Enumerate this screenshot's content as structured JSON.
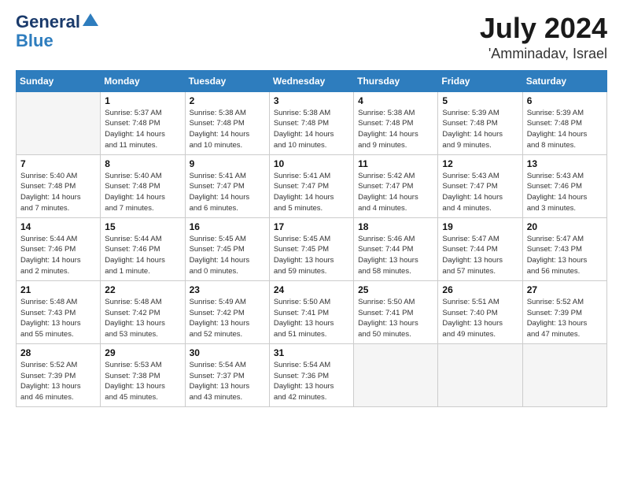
{
  "logo": {
    "line1": "General",
    "line2": "Blue"
  },
  "header": {
    "month_year": "July 2024",
    "location": "'Amminadav, Israel"
  },
  "days_of_week": [
    "Sunday",
    "Monday",
    "Tuesday",
    "Wednesday",
    "Thursday",
    "Friday",
    "Saturday"
  ],
  "weeks": [
    [
      {
        "day": "",
        "empty": true
      },
      {
        "day": "1",
        "sunrise": "5:37 AM",
        "sunset": "7:48 PM",
        "daylight": "14 hours and 11 minutes."
      },
      {
        "day": "2",
        "sunrise": "5:38 AM",
        "sunset": "7:48 PM",
        "daylight": "14 hours and 10 minutes."
      },
      {
        "day": "3",
        "sunrise": "5:38 AM",
        "sunset": "7:48 PM",
        "daylight": "14 hours and 10 minutes."
      },
      {
        "day": "4",
        "sunrise": "5:38 AM",
        "sunset": "7:48 PM",
        "daylight": "14 hours and 9 minutes."
      },
      {
        "day": "5",
        "sunrise": "5:39 AM",
        "sunset": "7:48 PM",
        "daylight": "14 hours and 9 minutes."
      },
      {
        "day": "6",
        "sunrise": "5:39 AM",
        "sunset": "7:48 PM",
        "daylight": "14 hours and 8 minutes."
      }
    ],
    [
      {
        "day": "7",
        "sunrise": "5:40 AM",
        "sunset": "7:48 PM",
        "daylight": "14 hours and 7 minutes."
      },
      {
        "day": "8",
        "sunrise": "5:40 AM",
        "sunset": "7:48 PM",
        "daylight": "14 hours and 7 minutes."
      },
      {
        "day": "9",
        "sunrise": "5:41 AM",
        "sunset": "7:47 PM",
        "daylight": "14 hours and 6 minutes."
      },
      {
        "day": "10",
        "sunrise": "5:41 AM",
        "sunset": "7:47 PM",
        "daylight": "14 hours and 5 minutes."
      },
      {
        "day": "11",
        "sunrise": "5:42 AM",
        "sunset": "7:47 PM",
        "daylight": "14 hours and 4 minutes."
      },
      {
        "day": "12",
        "sunrise": "5:43 AM",
        "sunset": "7:47 PM",
        "daylight": "14 hours and 4 minutes."
      },
      {
        "day": "13",
        "sunrise": "5:43 AM",
        "sunset": "7:46 PM",
        "daylight": "14 hours and 3 minutes."
      }
    ],
    [
      {
        "day": "14",
        "sunrise": "5:44 AM",
        "sunset": "7:46 PM",
        "daylight": "14 hours and 2 minutes."
      },
      {
        "day": "15",
        "sunrise": "5:44 AM",
        "sunset": "7:46 PM",
        "daylight": "14 hours and 1 minute."
      },
      {
        "day": "16",
        "sunrise": "5:45 AM",
        "sunset": "7:45 PM",
        "daylight": "14 hours and 0 minutes."
      },
      {
        "day": "17",
        "sunrise": "5:45 AM",
        "sunset": "7:45 PM",
        "daylight": "13 hours and 59 minutes."
      },
      {
        "day": "18",
        "sunrise": "5:46 AM",
        "sunset": "7:44 PM",
        "daylight": "13 hours and 58 minutes."
      },
      {
        "day": "19",
        "sunrise": "5:47 AM",
        "sunset": "7:44 PM",
        "daylight": "13 hours and 57 minutes."
      },
      {
        "day": "20",
        "sunrise": "5:47 AM",
        "sunset": "7:43 PM",
        "daylight": "13 hours and 56 minutes."
      }
    ],
    [
      {
        "day": "21",
        "sunrise": "5:48 AM",
        "sunset": "7:43 PM",
        "daylight": "13 hours and 55 minutes."
      },
      {
        "day": "22",
        "sunrise": "5:48 AM",
        "sunset": "7:42 PM",
        "daylight": "13 hours and 53 minutes."
      },
      {
        "day": "23",
        "sunrise": "5:49 AM",
        "sunset": "7:42 PM",
        "daylight": "13 hours and 52 minutes."
      },
      {
        "day": "24",
        "sunrise": "5:50 AM",
        "sunset": "7:41 PM",
        "daylight": "13 hours and 51 minutes."
      },
      {
        "day": "25",
        "sunrise": "5:50 AM",
        "sunset": "7:41 PM",
        "daylight": "13 hours and 50 minutes."
      },
      {
        "day": "26",
        "sunrise": "5:51 AM",
        "sunset": "7:40 PM",
        "daylight": "13 hours and 49 minutes."
      },
      {
        "day": "27",
        "sunrise": "5:52 AM",
        "sunset": "7:39 PM",
        "daylight": "13 hours and 47 minutes."
      }
    ],
    [
      {
        "day": "28",
        "sunrise": "5:52 AM",
        "sunset": "7:39 PM",
        "daylight": "13 hours and 46 minutes."
      },
      {
        "day": "29",
        "sunrise": "5:53 AM",
        "sunset": "7:38 PM",
        "daylight": "13 hours and 45 minutes."
      },
      {
        "day": "30",
        "sunrise": "5:54 AM",
        "sunset": "7:37 PM",
        "daylight": "13 hours and 43 minutes."
      },
      {
        "day": "31",
        "sunrise": "5:54 AM",
        "sunset": "7:36 PM",
        "daylight": "13 hours and 42 minutes."
      },
      {
        "day": "",
        "empty": true
      },
      {
        "day": "",
        "empty": true
      },
      {
        "day": "",
        "empty": true
      }
    ]
  ]
}
